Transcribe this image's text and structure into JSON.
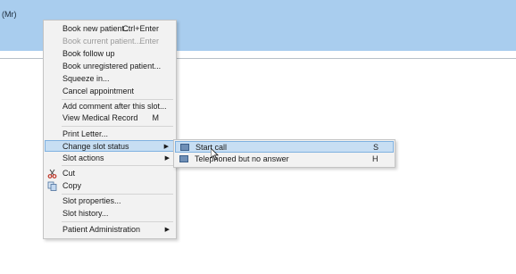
{
  "header": {
    "title": "(Mr)"
  },
  "context_menu": {
    "items": [
      {
        "label": "Book new patient...",
        "shortcut": "Ctrl+Enter"
      },
      {
        "label": "Book current patient...",
        "shortcut": "Enter"
      },
      {
        "label": "Book follow up"
      },
      {
        "label": "Book unregistered patient..."
      },
      {
        "label": "Squeeze in..."
      },
      {
        "label": "Cancel appointment"
      },
      {
        "label": "Add comment after this slot..."
      },
      {
        "label": "View Medical Record",
        "shortcut": "M"
      },
      {
        "label": "Print Letter..."
      },
      {
        "label": "Change slot status"
      },
      {
        "label": "Slot actions"
      },
      {
        "label": "Cut"
      },
      {
        "label": "Copy"
      },
      {
        "label": "Slot properties..."
      },
      {
        "label": "Slot history..."
      },
      {
        "label": "Patient Administration"
      }
    ],
    "disabled_items": [
      "Book current patient..."
    ],
    "highlighted_item": "Change slot status",
    "icons": {
      "cut": "scissors-icon",
      "copy": "copy-icon",
      "submenu": "chevron-right-icon"
    }
  },
  "submenu": {
    "items": [
      {
        "label": "Start call",
        "shortcut": "S",
        "icon": "phone-slot-icon"
      },
      {
        "label": "Telephoned but no answer",
        "shortcut": "H",
        "icon": "phone-slot-icon"
      }
    ],
    "highlighted_item": "Start call"
  },
  "colors": {
    "header_band": "#a9cdee",
    "highlight": "#c7def3",
    "highlight_border": "#7fb1e0",
    "menu_bg": "#f2f2f2"
  }
}
